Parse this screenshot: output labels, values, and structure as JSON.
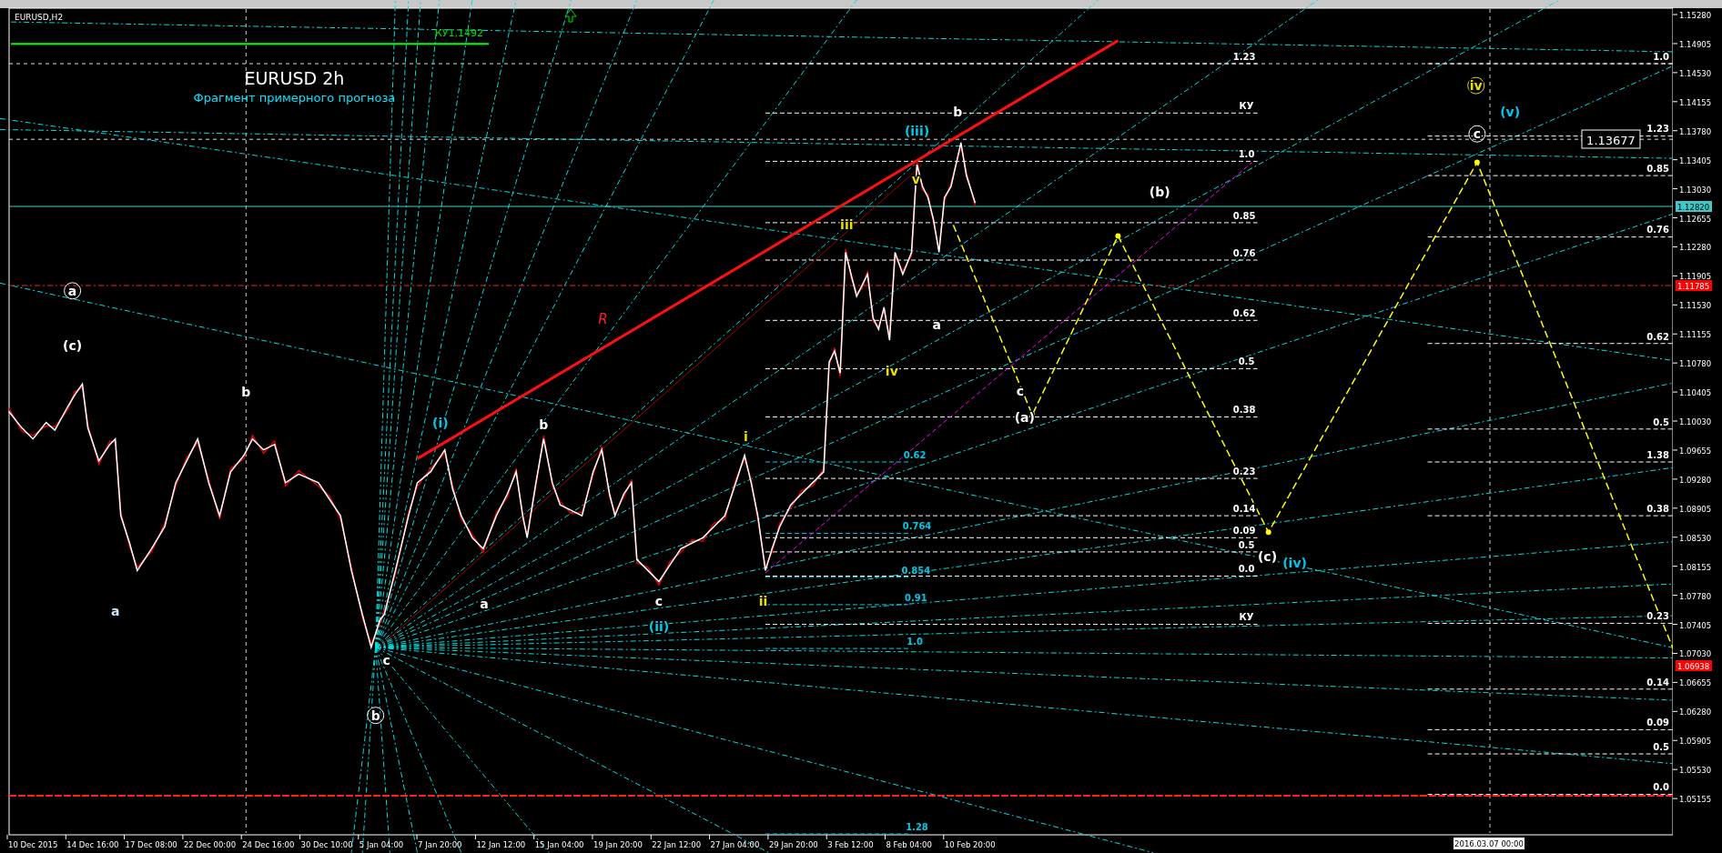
{
  "chart": {
    "symbol_label": "EURUSD,H2",
    "title": "EURUSD 2h",
    "subtitle": "Фрагмент примерного прогноза",
    "level_label": "КУ1,1492",
    "trend_label": "R",
    "target_price": "1.13677"
  },
  "waves": [
    {
      "text": "a",
      "color": "#ffffff",
      "circled": true
    },
    {
      "text": "(c)",
      "color": "#ffffff",
      "circled": false
    },
    {
      "text": "b",
      "color": "#ffffff",
      "circled": false
    },
    {
      "text": "a",
      "color": "#c8e8ff",
      "circled": false
    },
    {
      "text": "b",
      "color": "#ffffff",
      "circled": true
    },
    {
      "text": "c",
      "color": "#ffffff",
      "circled": false
    },
    {
      "text": "(i)",
      "color": "#00c8e8",
      "circled": false
    },
    {
      "text": "b",
      "color": "#ffffff",
      "circled": false
    },
    {
      "text": "a",
      "color": "#ffffff",
      "circled": false
    },
    {
      "text": "c",
      "color": "#ffffff",
      "circled": false
    },
    {
      "text": "(ii)",
      "color": "#00c8e8",
      "circled": false
    },
    {
      "text": "i",
      "color": "#e8e000",
      "circled": false
    },
    {
      "text": "ii",
      "color": "#e8e000",
      "circled": false
    },
    {
      "text": "iii",
      "color": "#e8e000",
      "circled": false
    },
    {
      "text": "iv",
      "color": "#e8e000",
      "circled": false
    },
    {
      "text": "v",
      "color": "#e8e000",
      "circled": false
    },
    {
      "text": "(iii)",
      "color": "#00c8e8",
      "circled": false
    },
    {
      "text": "b",
      "color": "#ffffff",
      "circled": false
    },
    {
      "text": "a",
      "color": "#ffffff",
      "circled": false
    },
    {
      "text": "c",
      "color": "#ffffff",
      "circled": false
    },
    {
      "text": "(a)",
      "color": "#ffffff",
      "circled": false
    },
    {
      "text": "(b)",
      "color": "#ffffff",
      "circled": false
    },
    {
      "text": "(c)",
      "color": "#ffffff",
      "circled": false
    },
    {
      "text": "(iv)",
      "color": "#00c8e8",
      "circled": false
    },
    {
      "text": "iv",
      "color": "#e8e000",
      "circled": true
    },
    {
      "text": "(v)",
      "color": "#00c8e8",
      "circled": false
    },
    {
      "text": "c",
      "color": "#ffffff",
      "circled": true
    }
  ],
  "fib_labels": [
    {
      "text": "1.23",
      "color": "#ffffff"
    },
    {
      "text": "КУ",
      "color": "#ffffff"
    },
    {
      "text": "1.0",
      "color": "#ffffff"
    },
    {
      "text": "0.85",
      "color": "#ffffff"
    },
    {
      "text": "0.76",
      "color": "#ffffff"
    },
    {
      "text": "0.62",
      "color": "#ffffff"
    },
    {
      "text": "0.5",
      "color": "#ffffff"
    },
    {
      "text": "0.38",
      "color": "#ffffff"
    },
    {
      "text": "0.23",
      "color": "#ffffff"
    },
    {
      "text": "0.14",
      "color": "#ffffff"
    },
    {
      "text": "0.09",
      "color": "#ffffff"
    },
    {
      "text": "0.5",
      "color": "#ffffff"
    },
    {
      "text": "0.0",
      "color": "#ffffff"
    },
    {
      "text": "КУ",
      "color": "#ffffff"
    },
    {
      "text": "0.62",
      "color": "#00c8e8"
    },
    {
      "text": "0.764",
      "color": "#00c8e8"
    },
    {
      "text": "0.854",
      "color": "#00c8e8"
    },
    {
      "text": "0.91",
      "color": "#00c8e8"
    },
    {
      "text": "1.0",
      "color": "#00c8e8"
    },
    {
      "text": "1.28",
      "color": "#00c8e8"
    },
    {
      "text": "1.0",
      "color": "#ffffff"
    },
    {
      "text": "1.23",
      "color": "#ffffff"
    },
    {
      "text": "0.85",
      "color": "#ffffff"
    },
    {
      "text": "0.76",
      "color": "#ffffff"
    },
    {
      "text": "0.62",
      "color": "#ffffff"
    },
    {
      "text": "0.5",
      "color": "#ffffff"
    },
    {
      "text": "1.38",
      "color": "#ffffff"
    },
    {
      "text": "0.38",
      "color": "#ffffff"
    },
    {
      "text": "0.23",
      "color": "#ffffff"
    },
    {
      "text": "0.14",
      "color": "#ffffff"
    },
    {
      "text": "0.09",
      "color": "#ffffff"
    },
    {
      "text": "0.5",
      "color": "#ffffff"
    },
    {
      "text": "0.0",
      "color": "#ffffff"
    }
  ],
  "price_axis": [
    "1.15280",
    "1.14905",
    "1.14530",
    "1.14155",
    "1.13780",
    "1.13405",
    "1.13030",
    "1.12655",
    "1.12280",
    "1.11905",
    "1.11530",
    "1.11155",
    "1.10780",
    "1.10405",
    "1.10030",
    "1.09655",
    "1.09280",
    "1.08905",
    "1.08530",
    "1.08155",
    "1.07780",
    "1.07405",
    "1.07030",
    "1.06655",
    "1.06280",
    "1.05905",
    "1.05530",
    "1.05155"
  ],
  "price_badges": [
    {
      "text": "1.12820",
      "color": "#40c8c8"
    },
    {
      "text": "1.11785",
      "color": "#ff0000"
    },
    {
      "text": "1.06938",
      "color": "#ff0000"
    }
  ],
  "time_axis": [
    "10 Dec 2015",
    "14 Dec 16:00",
    "17 Dec 08:00",
    "22 Dec 00:00",
    "24 Dec 16:00",
    "30 Dec 10:00",
    "5 Jan 04:00",
    "7 Jan 20:00",
    "12 Jan 12:00",
    "15 Jan 04:00",
    "19 Jan 20:00",
    "22 Jan 12:00",
    "27 Jan 04:00",
    "29 Jan 20:00",
    "3 Feb 12:00",
    "8 Feb 04:00",
    "10 Feb 20:00"
  ],
  "time_badge": "2016.03.07 00:00"
}
